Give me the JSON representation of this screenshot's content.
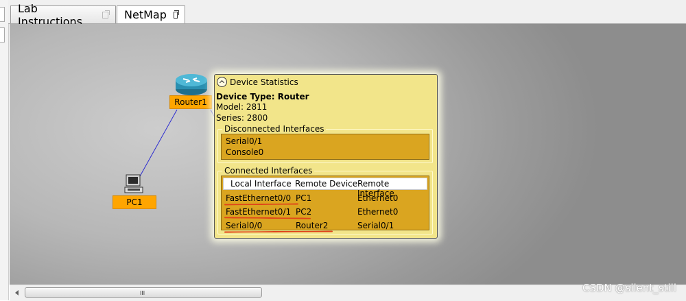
{
  "tabs": [
    {
      "label": "Lab Instructions",
      "icon": "popout-icon",
      "active": false
    },
    {
      "label": "NetMap",
      "icon": "popout-icon",
      "active": true
    }
  ],
  "devices": {
    "router": {
      "label": "Router1",
      "icon": "router-icon"
    },
    "pc": {
      "label": "PC1",
      "icon": "pc-icon"
    }
  },
  "popup": {
    "title": "Device Statistics",
    "device_type": "Device Type: Router",
    "model": "Model: 2811",
    "series": "Series: 2800",
    "disconnected": {
      "title": "Disconnected Interfaces",
      "items": [
        "Serial0/1",
        "Console0"
      ]
    },
    "connected": {
      "title": "Connected Interfaces",
      "headers": [
        "Local Interface",
        "Remote Device",
        "Remote Interface"
      ],
      "rows": [
        [
          "FastEthernet0/0",
          "PC1",
          "Ethernet0"
        ],
        [
          "FastEthernet0/1",
          "PC2",
          "Ethernet0"
        ],
        [
          "Serial0/0",
          "Router2",
          "Serial0/1"
        ]
      ]
    }
  },
  "scrollbar": {
    "grip": "III"
  },
  "watermark": "CSDN @silent_still",
  "colors": {
    "device_label": "#ffa500",
    "popup_bg": "#f2e58a",
    "table_bg": "#daa520",
    "annotation": "#e0441a",
    "link": "#2a2ad0"
  }
}
